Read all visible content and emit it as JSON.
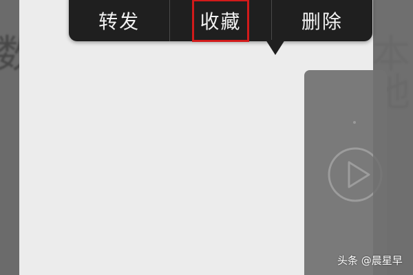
{
  "background": {
    "left_fragment": "数亻",
    "right_fragment": "本地"
  },
  "context_menu": {
    "items": [
      {
        "label": "转发",
        "highlighted": false
      },
      {
        "label": "收藏",
        "highlighted": true
      },
      {
        "label": "删除",
        "highlighted": false
      }
    ],
    "highlight_color": "#d21a1a"
  },
  "video_bubble": {
    "icon": "play-icon"
  },
  "watermark": {
    "text": "头条 @晨星早"
  },
  "colors": {
    "menu_background": "#1f1f1f",
    "surface": "#ececec",
    "outer": "#6b6b6b"
  }
}
